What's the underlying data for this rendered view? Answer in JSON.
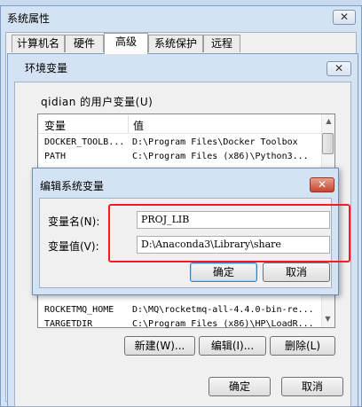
{
  "sys_window": {
    "title": "系统属性",
    "close_label": "✕",
    "tabs": [
      {
        "label": "计算机名"
      },
      {
        "label": "硬件"
      },
      {
        "label": "高级"
      },
      {
        "label": "系统保护"
      },
      {
        "label": "远程"
      }
    ],
    "ok_label": "确定",
    "cancel_label": "取消"
  },
  "env_window": {
    "title": "环境变量",
    "close_label": "✕",
    "user_vars_label": "qidian 的用户变量(U)",
    "columns": {
      "name": "变量",
      "value": "值"
    },
    "rows": [
      {
        "name": "DOCKER_TOOLB...",
        "value": "D:\\Program Files\\Docker Toolbox"
      },
      {
        "name": "PATH",
        "value": "C:\\Program Files (x86)\\Python3..."
      },
      {
        "name": "ROCKETMQ_HOME",
        "value": "D:\\MQ\\rocketmq-all-4.4.0-bin-re..."
      },
      {
        "name": "TARGETDIR",
        "value": "C:\\Program Files (x86)\\HP\\LoadR..."
      }
    ],
    "new_label": "新建(W)...",
    "edit_label": "编辑(I)...",
    "delete_label": "删除(L)"
  },
  "edit_dialog": {
    "title": "编辑系统变量",
    "close_label": "✕",
    "name_label": "变量名(N):",
    "value_label": "变量值(V):",
    "name_value": "PROJ_LIB",
    "value_value": "D:\\Anaconda3\\Library\\share",
    "ok_label": "确定",
    "cancel_label": "取消"
  },
  "colors": {
    "highlight": "#ff1a1a",
    "close_red": "#c8452c",
    "frame": "#d4e3f3"
  }
}
